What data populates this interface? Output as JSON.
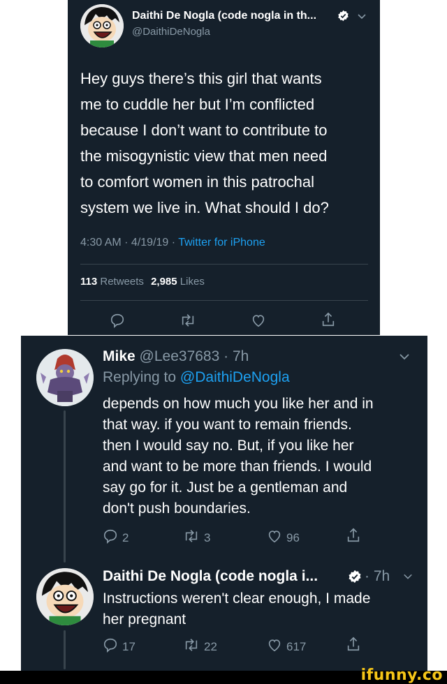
{
  "main_tweet": {
    "display_name": "Daithi De Nogla (code nogla in th...",
    "handle": "@DaithiDeNogla",
    "text_lines": [
      "Hey guys there’s this girl that wants",
      "me to cuddle her but I’m conflicted",
      "because I don’t want to contribute to",
      "the misogynistic view that men need",
      "to comfort women in this patrochal",
      "system we live in. What should I do?"
    ],
    "timestamp": "4:30 AM · 4/19/19 · ",
    "source": "Twitter for iPhone",
    "retweets_count": "113",
    "retweets_label": "Retweets",
    "likes_count": "2,985",
    "likes_label": "Likes"
  },
  "reply_1": {
    "display_name": "Mike",
    "handle_time": "@Lee37683 · 7h",
    "replying_to_label": "Replying to",
    "replying_to_handle": "@DaithiDeNogla",
    "text_lines": [
      "depends on how much you like her and in",
      "that way. if you want to remain friends.",
      "then I would say no. But, if you like her",
      "and want to be more than friends. I would",
      "say go for it. Just be a gentleman and",
      "don't push boundaries."
    ],
    "replies": "2",
    "retweets": "3",
    "likes": "96"
  },
  "reply_2": {
    "display_name": "Daithi De Nogla (code nogla i...",
    "time": "· 7h",
    "text_lines": [
      "Instructions weren't clear enough, I made",
      "her pregnant"
    ],
    "replies": "17",
    "retweets": "22",
    "likes": "617"
  },
  "watermark": {
    "text": "ifunny.co"
  }
}
